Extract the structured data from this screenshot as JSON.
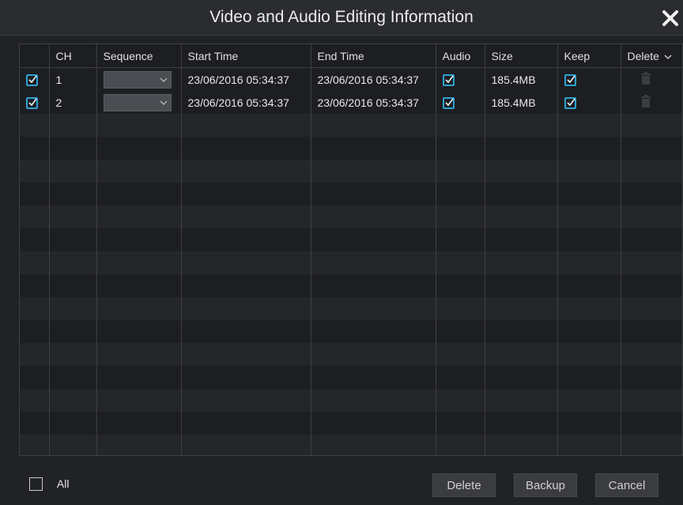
{
  "dialog": {
    "title": "Video and Audio Editing Information"
  },
  "table": {
    "headers": {
      "ch": "CH",
      "sequence": "Sequence",
      "start_time": "Start Time",
      "end_time": "End Time",
      "audio": "Audio",
      "size": "Size",
      "keep": "Keep",
      "delete": "Delete"
    },
    "rows": [
      {
        "checked": true,
        "ch": "1",
        "sequence": "",
        "start_time": "23/06/2016 05:34:37",
        "end_time": "23/06/2016 05:34:37",
        "audio": true,
        "size": "185.4MB",
        "keep": true
      },
      {
        "checked": true,
        "ch": "2",
        "sequence": "",
        "start_time": "23/06/2016 05:34:37",
        "end_time": "23/06/2016 05:34:37",
        "audio": true,
        "size": "185.4MB",
        "keep": true
      }
    ]
  },
  "footer": {
    "all_label": "All",
    "all_checked": false,
    "delete_label": "Delete",
    "backup_label": "Backup",
    "cancel_label": "Cancel"
  },
  "colors": {
    "checkbox_accent": "#2ea3d3",
    "background": "#202226"
  },
  "icons": {
    "close": "close-icon",
    "trash": "trash-icon",
    "dropdown": "chevron-down-icon"
  }
}
